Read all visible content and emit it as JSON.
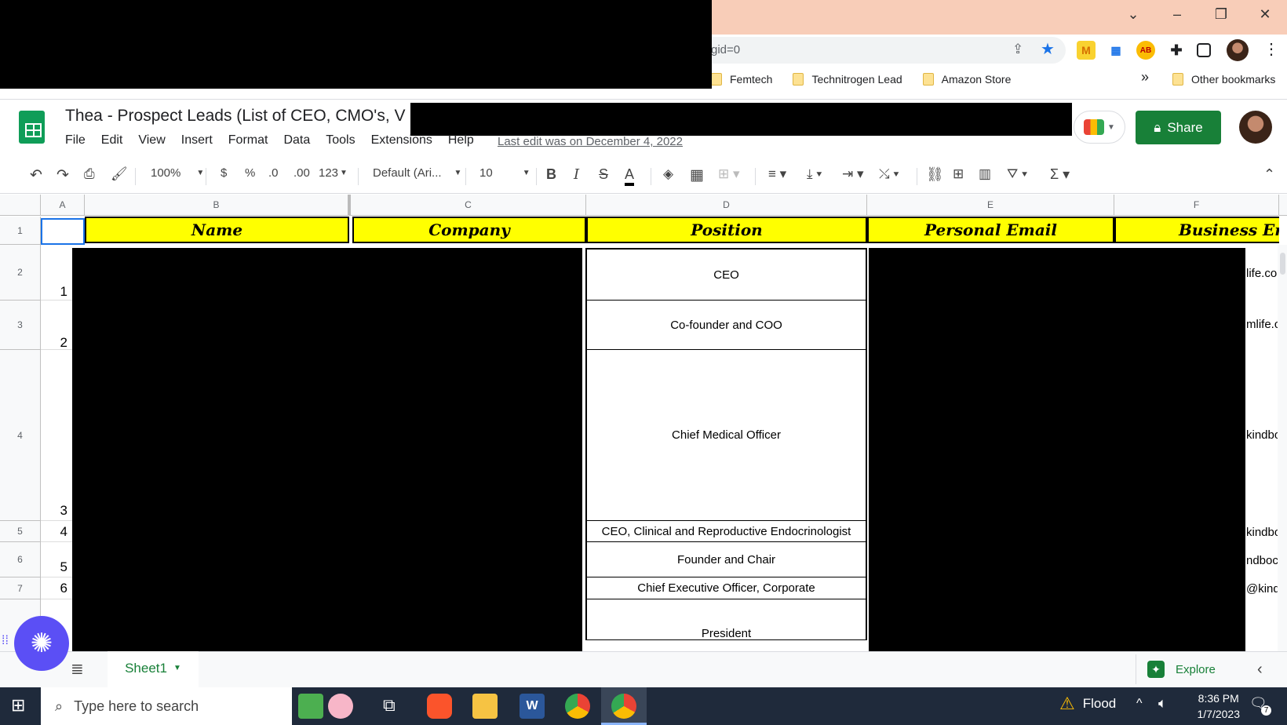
{
  "browser": {
    "omnibox_text": "gid=0",
    "bookmarks": [
      "Femtech",
      "Technitrogen Lead",
      "Amazon Store"
    ],
    "more_label": "»",
    "other_bookmarks": "Other bookmarks"
  },
  "sheets": {
    "title": "Thea -  Prospect Leads (List of CEO, CMO's, V",
    "menu": [
      "File",
      "Edit",
      "View",
      "Insert",
      "Format",
      "Data",
      "Tools",
      "Extensions",
      "Help"
    ],
    "last_edit": "Last edit was on December 4, 2022",
    "share_label": "Share"
  },
  "toolbar": {
    "zoom": "100%",
    "currency": "$",
    "percent": "%",
    "dec_less": ".0",
    "dec_more": ".00",
    "format_more": "123",
    "font": "Default (Ari...",
    "font_size": "10"
  },
  "grid": {
    "columns": [
      "A",
      "B",
      "C",
      "D",
      "E",
      "F"
    ],
    "rows": [
      "1",
      "2",
      "3",
      "4",
      "5",
      "6",
      "7"
    ],
    "header": {
      "name": "Name",
      "company": "Company",
      "position": "Position",
      "personal_email": "Personal Email",
      "business_email": "Business Em"
    },
    "data_rows": [
      {
        "num": "1",
        "position": "CEO",
        "biz": "life.co"
      },
      {
        "num": "2",
        "position": "Co-founder and COO",
        "biz": "mlife.c"
      },
      {
        "num": "3",
        "position": "Chief Medical Officer",
        "biz": "kindbo"
      },
      {
        "num": "4",
        "position": "CEO, Clinical and Reproductive Endocrinologist",
        "biz": "kindbo"
      },
      {
        "num": "5",
        "position": "Founder and Chair",
        "biz": "ndboc"
      },
      {
        "num": "6",
        "position": "Chief Executive Officer, Corporate",
        "biz": "@kind"
      },
      {
        "num": "",
        "position": "President",
        "biz": ""
      }
    ]
  },
  "bottom": {
    "sheet_tab": "Sheet1",
    "explore": "Explore"
  },
  "taskbar": {
    "search_placeholder": "Type here to search",
    "weather": "Flood",
    "time": "8:36 PM",
    "date": "1/7/2023",
    "notifications": "7"
  },
  "colors": {
    "header_yellow": "#ffff00",
    "share_green": "#188038",
    "chrome_peach": "#f8cdb8"
  }
}
